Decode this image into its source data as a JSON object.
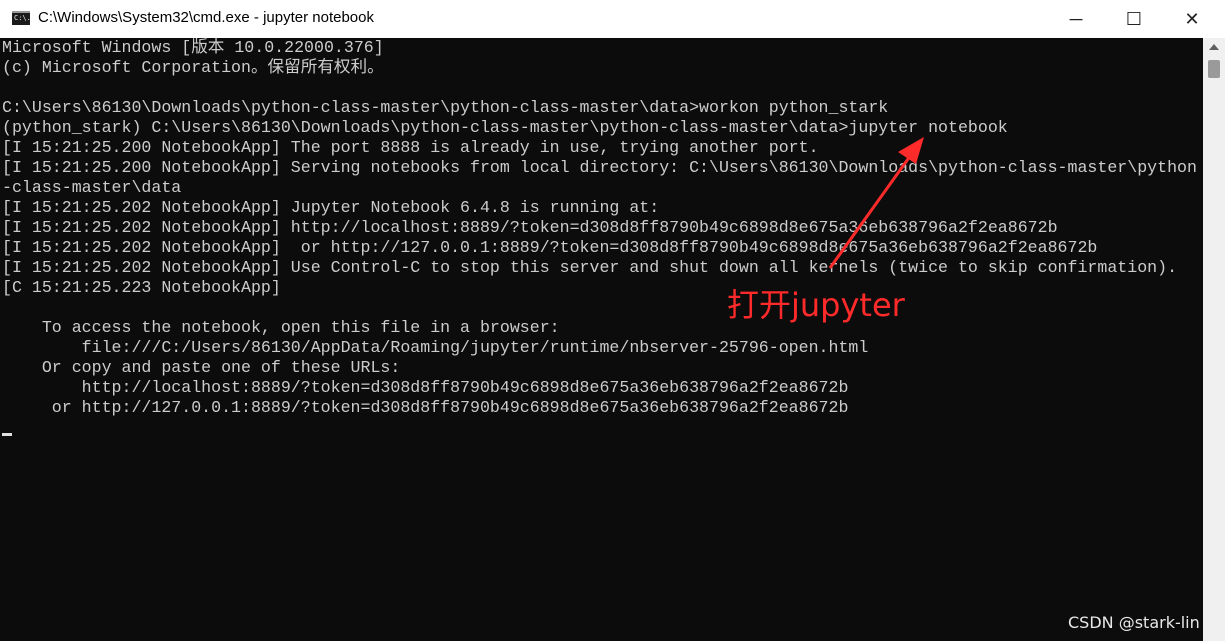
{
  "window": {
    "title": "C:\\Windows\\System32\\cmd.exe - jupyter  notebook",
    "icon": "cmd-icon",
    "icon_text": "C:\\.",
    "minimize_label": "─",
    "maximize_label": "☐",
    "close_label": "✕"
  },
  "console": {
    "lines": [
      "Microsoft Windows [版本 10.0.22000.376]",
      "(c) Microsoft Corporation。保留所有权利。",
      "",
      "C:\\Users\\86130\\Downloads\\python-class-master\\python-class-master\\data>workon python_stark",
      "(python_stark) C:\\Users\\86130\\Downloads\\python-class-master\\python-class-master\\data>jupyter notebook",
      "[I 15:21:25.200 NotebookApp] The port 8888 is already in use, trying another port.",
      "[I 15:21:25.200 NotebookApp] Serving notebooks from local directory: C:\\Users\\86130\\Downloads\\python-class-master\\python",
      "-class-master\\data",
      "[I 15:21:25.202 NotebookApp] Jupyter Notebook 6.4.8 is running at:",
      "[I 15:21:25.202 NotebookApp] http://localhost:8889/?token=d308d8ff8790b49c6898d8e675a36eb638796a2f2ea8672b",
      "[I 15:21:25.202 NotebookApp]  or http://127.0.0.1:8889/?token=d308d8ff8790b49c6898d8e675a36eb638796a2f2ea8672b",
      "[I 15:21:25.202 NotebookApp] Use Control-C to stop this server and shut down all kernels (twice to skip confirmation).",
      "[C 15:21:25.223 NotebookApp]",
      "",
      "    To access the notebook, open this file in a browser:",
      "        file:///C:/Users/86130/AppData/Roaming/jupyter/runtime/nbserver-25796-open.html",
      "    Or copy and paste one of these URLs:",
      "        http://localhost:8889/?token=d308d8ff8790b49c6898d8e675a36eb638796a2f2ea8672b",
      "     or http://127.0.0.1:8889/?token=d308d8ff8790b49c6898d8e675a36eb638796a2f2ea8672b"
    ]
  },
  "annotation": {
    "text": "打开jupyter",
    "color": "#ff2a2a"
  },
  "watermark": "CSDN @stark-lin",
  "colors": {
    "console_bg": "#0c0c0c",
    "console_text": "#cccccc"
  }
}
